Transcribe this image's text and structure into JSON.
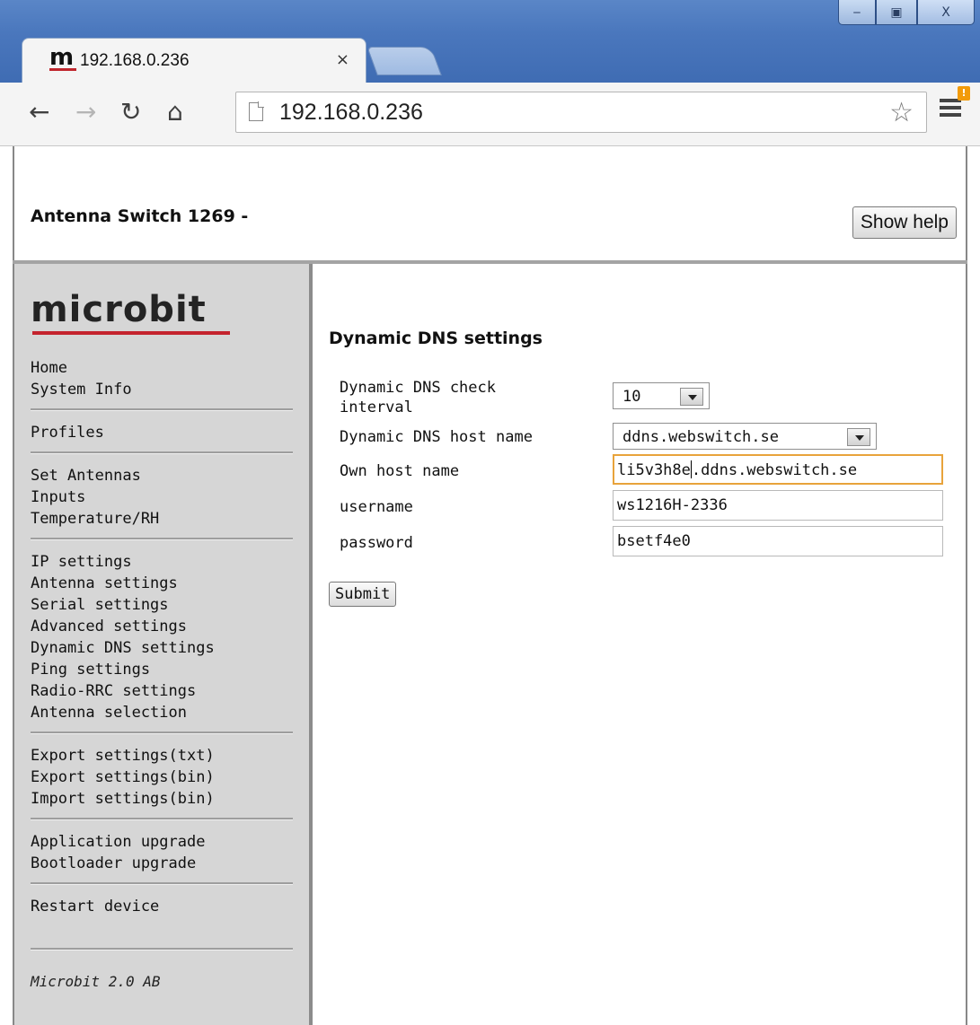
{
  "browser": {
    "tab_title": "192.168.0.236",
    "tab_favicon": "m",
    "tab_close": "×",
    "url": "192.168.0.236",
    "window_buttons": {
      "minimize": "‒",
      "maximize": "▣",
      "close": "X"
    },
    "menu_badge": "!"
  },
  "header": {
    "title": "Antenna Switch 1269 -",
    "help_button": "Show help"
  },
  "sidebar": {
    "logo": "microbit",
    "groups": [
      [
        "Home",
        "System Info"
      ],
      [
        "Profiles"
      ],
      [
        "Set Antennas",
        "Inputs",
        "Temperature/RH"
      ],
      [
        "IP settings",
        "Antenna settings",
        "Serial settings",
        "Advanced settings",
        "Dynamic DNS settings",
        "Ping settings",
        "Radio-RRC settings",
        "Antenna selection"
      ],
      [
        "Export settings(txt)",
        "Export settings(bin)",
        "Import settings(bin)"
      ],
      [
        "Application upgrade",
        "Bootloader upgrade"
      ],
      [
        "Restart device"
      ]
    ],
    "footer": "Microbit 2.0 AB"
  },
  "form": {
    "section_title": "Dynamic DNS settings",
    "check_interval": {
      "label_line1": "Dynamic DNS check",
      "label_line2": "interval",
      "value": "10"
    },
    "host_name": {
      "label": "Dynamic DNS host name",
      "value": "ddns.webswitch.se"
    },
    "own_host": {
      "label": "Own host name",
      "value_before_caret": "li5v3h8e",
      "value_after_caret": ".ddns.webswitch.se"
    },
    "username": {
      "label": "username",
      "value": "ws1216H-2336"
    },
    "password": {
      "label": "password",
      "value": "bsetf4e0"
    },
    "submit": "Submit"
  },
  "colors": {
    "titlebar": "#4a77bd",
    "logo_underline": "#c4232d",
    "focus_border": "#e8a33b",
    "sidebar_bg": "#d6d6d6"
  }
}
